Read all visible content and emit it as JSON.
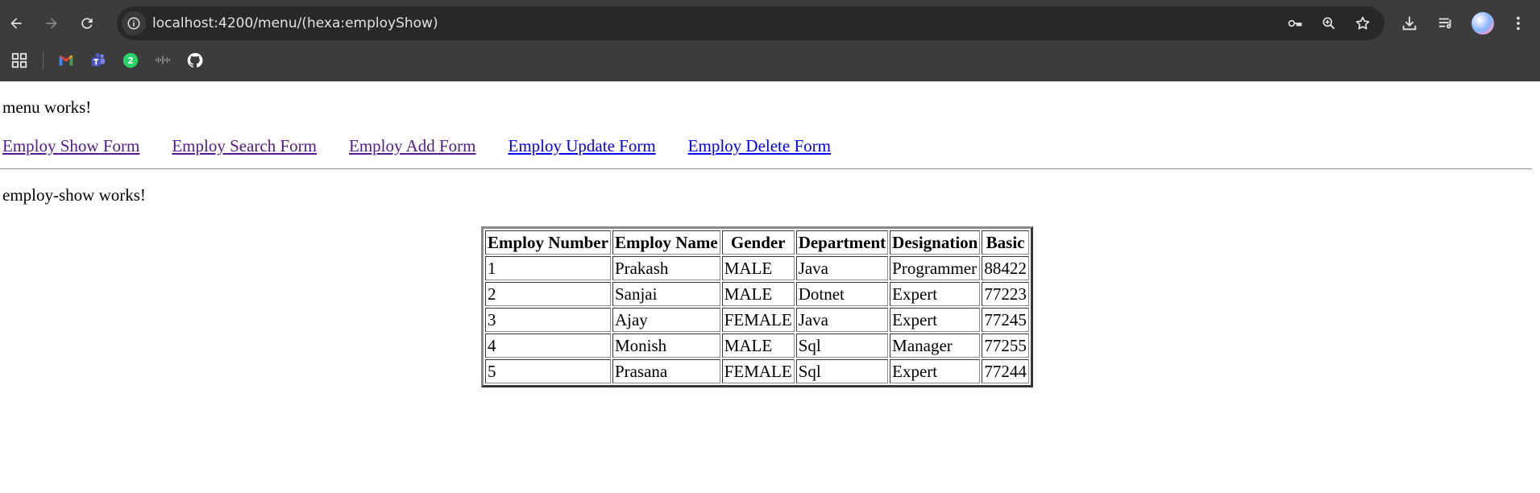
{
  "browser": {
    "url": "localhost:4200/menu/(hexa:employShow)",
    "toolbar_icons": [
      "back-icon",
      "forward-icon",
      "reload-icon",
      "site-info-icon",
      "password-key-icon",
      "zoom-icon",
      "bookmark-star-icon",
      "download-icon",
      "reading-list-icon",
      "profile-avatar",
      "more-menu-icon"
    ],
    "bookmarks": [
      {
        "name": "apps-grid-icon"
      },
      {
        "name": "gmail-icon"
      },
      {
        "name": "teams-icon"
      },
      {
        "name": "whatsapp-icon",
        "badge": "2"
      },
      {
        "name": "cisco-icon"
      },
      {
        "name": "github-icon"
      }
    ]
  },
  "page": {
    "menu_text": "menu works!",
    "nav_links": [
      {
        "label": "Employ Show Form",
        "visited": true
      },
      {
        "label": "Employ Search Form",
        "visited": true
      },
      {
        "label": "Employ Add Form",
        "visited": true
      },
      {
        "label": "Employ Update Form",
        "visited": false
      },
      {
        "label": "Employ Delete Form",
        "visited": false
      }
    ],
    "show_text": "employ-show works!",
    "table": {
      "headers": [
        "Employ Number",
        "Employ Name",
        "Gender",
        "Department",
        "Designation",
        "Basic"
      ],
      "rows": [
        [
          "1",
          "Prakash",
          "MALE",
          "Java",
          "Programmer",
          "88422"
        ],
        [
          "2",
          "Sanjai",
          "MALE",
          "Dotnet",
          "Expert",
          "77223"
        ],
        [
          "3",
          "Ajay",
          "FEMALE",
          "Java",
          "Expert",
          "77245"
        ],
        [
          "4",
          "Monish",
          "MALE",
          "Sql",
          "Manager",
          "77255"
        ],
        [
          "5",
          "Prasana",
          "FEMALE",
          "Sql",
          "Expert",
          "77244"
        ]
      ]
    }
  },
  "colors": {
    "chrome_bg": "#3c3c3c",
    "omnibox_bg": "#282828",
    "link": "#0000ee",
    "visited_link": "#551a8b"
  }
}
